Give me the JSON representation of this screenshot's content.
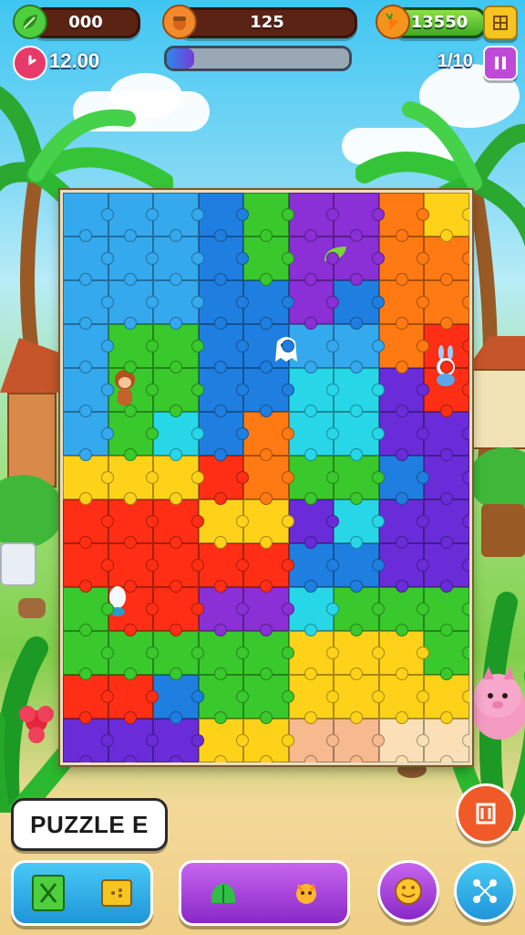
{
  "hud": {
    "coins": "000",
    "gems": "125",
    "score": "13550",
    "timer": "12.00",
    "progress_count": "1/10",
    "progress_fraction": 0.15
  },
  "label": {
    "title": "PUZZLE E"
  },
  "icons": {
    "coins": "leaf-icon",
    "gems": "acorn-icon",
    "score": "carrot-icon",
    "timer": "clock-icon",
    "settings": "grid-icon",
    "pause": "pause-icon",
    "hint": "hint-icon",
    "shuffle": "shuffle-icon"
  },
  "colors": {
    "board_palette": [
      "#35a9ee",
      "#1f7fe0",
      "#39c92c",
      "#8b2fd6",
      "#ff7a12",
      "#ffd21a",
      "#ff2e14",
      "#f7b98e",
      "#fbe0b7",
      "#27d7e8",
      "#6a2cd9",
      "#9fe04a"
    ]
  }
}
